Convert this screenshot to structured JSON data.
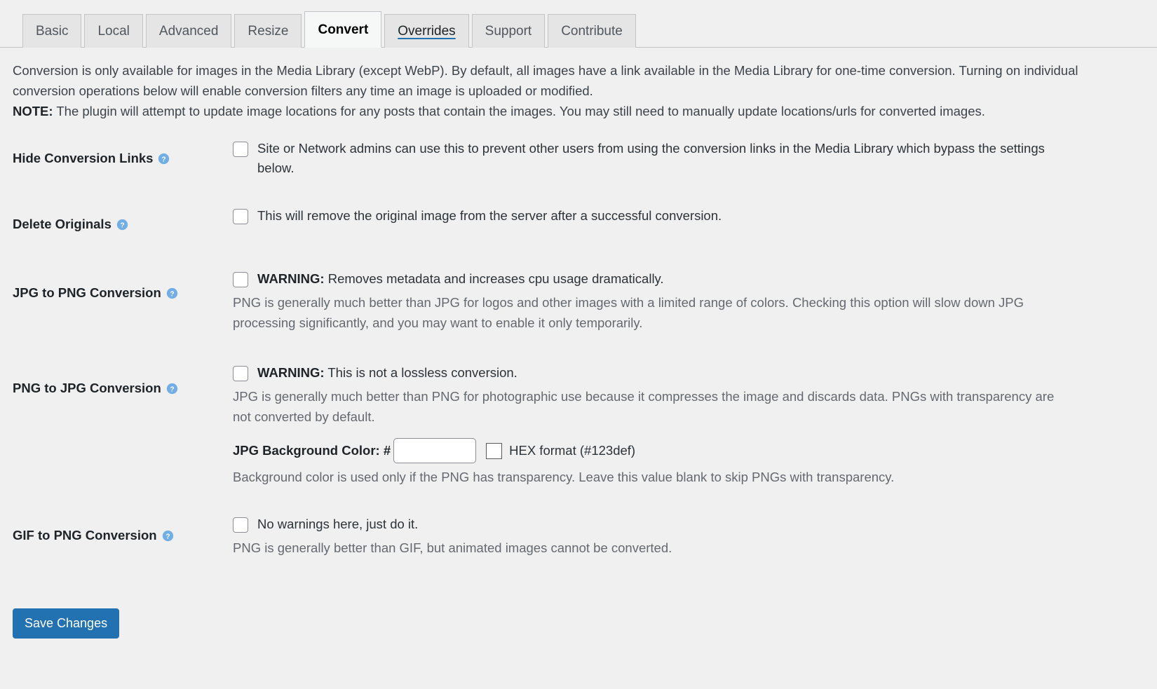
{
  "tabs": [
    {
      "label": "Basic",
      "state": "normal"
    },
    {
      "label": "Local",
      "state": "normal"
    },
    {
      "label": "Advanced",
      "state": "normal"
    },
    {
      "label": "Resize",
      "state": "normal"
    },
    {
      "label": "Convert",
      "state": "active"
    },
    {
      "label": "Overrides",
      "state": "linked"
    },
    {
      "label": "Support",
      "state": "normal"
    },
    {
      "label": "Contribute",
      "state": "normal"
    }
  ],
  "intro": {
    "paragraph1": "Conversion is only available for images in the Media Library (except WebP). By default, all images have a link available in the Media Library for one-time conversion. Turning on individual conversion operations below will enable conversion filters any time an image is uploaded or modified.",
    "note_label": "NOTE:",
    "note_text": " The plugin will attempt to update image locations for any posts that contain the images. You may still need to manually update locations/urls for converted images."
  },
  "settings": {
    "hide_conversion_links": {
      "label": "Hide Conversion Links",
      "help_icon": "help-circle-icon",
      "checkbox_text": "Site or Network admins can use this to prevent other users from using the conversion links in the Media Library which bypass the settings below.",
      "checked": false
    },
    "delete_originals": {
      "label": "Delete Originals",
      "help_icon": "help-circle-icon",
      "checkbox_text": "This will remove the original image from the server after a successful conversion.",
      "checked": false
    },
    "jpg_to_png": {
      "label": "JPG to PNG Conversion",
      "help_icon": "help-circle-icon",
      "warning_label": "WARNING:",
      "warning_text": " Removes metadata and increases cpu usage dramatically.",
      "description": "PNG is generally much better than JPG for logos and other images with a limited range of colors. Checking this option will slow down JPG processing significantly, and you may want to enable it only temporarily.",
      "checked": false
    },
    "png_to_jpg": {
      "label": "PNG to JPG Conversion",
      "help_icon": "help-circle-icon",
      "warning_label": "WARNING:",
      "warning_text": " This is not a lossless conversion.",
      "description": "JPG is generally much better than PNG for photographic use because it compresses the image and discards data. PNGs with transparency are not converted by default.",
      "bg_color_label": "JPG Background Color: #",
      "bg_color_value": "",
      "bg_color_placeholder": "",
      "color_swatch_name": "color-swatch",
      "hex_hint": "HEX format (#123def)",
      "footer_description": "Background color is used only if the PNG has transparency. Leave this value blank to skip PNGs with transparency.",
      "checked": false
    },
    "gif_to_png": {
      "label": "GIF to PNG Conversion",
      "help_icon": "help-circle-icon",
      "checkbox_text": "No warnings here, just do it.",
      "description": "PNG is generally better than GIF, but animated images cannot be converted.",
      "checked": false
    }
  },
  "submit": {
    "save_label": "Save Changes"
  },
  "colors": {
    "page_background": "#f0f0f1",
    "accent_blue": "#2271b1",
    "help_icon_blue": "#72aee6",
    "tab_inactive": "#e5e5e5",
    "tab_active": "#f6f7f7",
    "border": "#c3c4c7",
    "text": "#1d2327",
    "muted_text": "#646970"
  }
}
